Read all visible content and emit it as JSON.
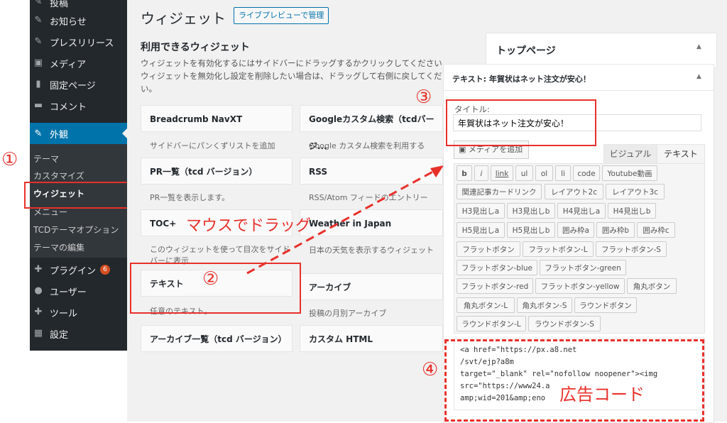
{
  "sidebar": {
    "top_item": "投稿",
    "items": [
      {
        "label": "お知らせ",
        "icon": "pin-icon"
      },
      {
        "label": "プレスリリース",
        "icon": "pin-icon"
      },
      {
        "label": "メディア",
        "icon": "media-icon"
      },
      {
        "label": "固定ページ",
        "icon": "page-icon"
      },
      {
        "label": "コメント",
        "icon": "comment-icon"
      }
    ],
    "active": "外観",
    "submenu": [
      "テーマ",
      "カスタマイズ",
      "ウィジェット",
      "メニュー",
      "TCDテーマオプション",
      "テーマの編集"
    ],
    "bottom_items": [
      {
        "label": "プラグイン",
        "icon": "plugin-icon",
        "badge": "6"
      },
      {
        "label": "ユーザー",
        "icon": "user-icon"
      },
      {
        "label": "ツール",
        "icon": "wrench-icon"
      },
      {
        "label": "設定",
        "icon": "settings-icon"
      }
    ]
  },
  "page": {
    "title": "ウィジェット",
    "live_button": "ライブプレビューで管理",
    "available_title": "利用できるウィジェット",
    "desc1": "ウィジェットを有効化するにはサイドバーにドラッグするかクリックしてください",
    "desc2": "ウィジェットを無効化し設定を削除したい場合は、ドラッグして右側に戻してくだ",
    "desc3": "い。"
  },
  "widgets": [
    {
      "title": "Breadcrumb NavXT",
      "desc": "サイドバーにパンくずリストを追加"
    },
    {
      "title": "Googleカスタム検索（tcdバージ...",
      "desc": "Google カスタム検索を利用する"
    },
    {
      "title": "PR一覧（tcd バージョン）",
      "desc": "PR一覧を表示します。"
    },
    {
      "title": "RSS",
      "desc": "RSS/Atom フィードのエントリー"
    },
    {
      "title": "TOC+",
      "desc1": "このウィジェットを使って目次をサイド",
      "desc2": "バーに表示"
    },
    {
      "title": "Weather in Japan",
      "desc": "日本の天気を表示するウィジェット"
    },
    {
      "title": "テキスト",
      "desc": "任意のテキスト。"
    },
    {
      "title": "アーカイブ",
      "desc": "投稿の月別アーカイブ"
    },
    {
      "title": "アーカイブ一覧（tcd バージョン）"
    },
    {
      "title": "カスタム HTML"
    }
  ],
  "panel": {
    "title": "トップページ",
    "widget_title": "テキスト: 年賀状はネット注文が安心！",
    "title_label": "タイトル:",
    "title_value": "年賀状はネット注文が安心！",
    "add_media": "メディアを追加",
    "tab_visual": "ビジュアル",
    "tab_text": "テキスト",
    "buttons": [
      "b",
      "i",
      "link",
      "ul",
      "ol",
      "li",
      "code",
      "Youtube動画",
      "関連記事カードリンク",
      "レイアウト2c",
      "レイアウト3c",
      "H3見出しa",
      "H3見出しb",
      "H4見出しa",
      "H4見出しb",
      "H5見出しa",
      "H5見出しb",
      "囲み枠a",
      "囲み枠b",
      "囲み枠c",
      "フラットボタン",
      "フラットボタン-L",
      "フラットボタン-S",
      "フラットボタン-blue",
      "フラットボタン-green",
      "フラットボタン-red",
      "フラットボタン-yellow",
      "角丸ボタン",
      "角丸ボタン-L",
      "角丸ボタン-S",
      "ラウンドボタン",
      "ラウンドボタン-L",
      "ラウンドボタン-S"
    ],
    "code": [
      "<a href=\"https://px.a8.net",
      "/svt/ejp?a8m",
      "target=\"_blank\" rel=\"nofollow noopener\"><img",
      "src=\"https://www24.a",
      "amp;wid=201&amp;eno"
    ]
  },
  "annotations": {
    "n1": "①",
    "n2": "②",
    "n3": "③",
    "n4": "④",
    "drag": "マウスでドラッグ",
    "ad": "広告コード"
  }
}
